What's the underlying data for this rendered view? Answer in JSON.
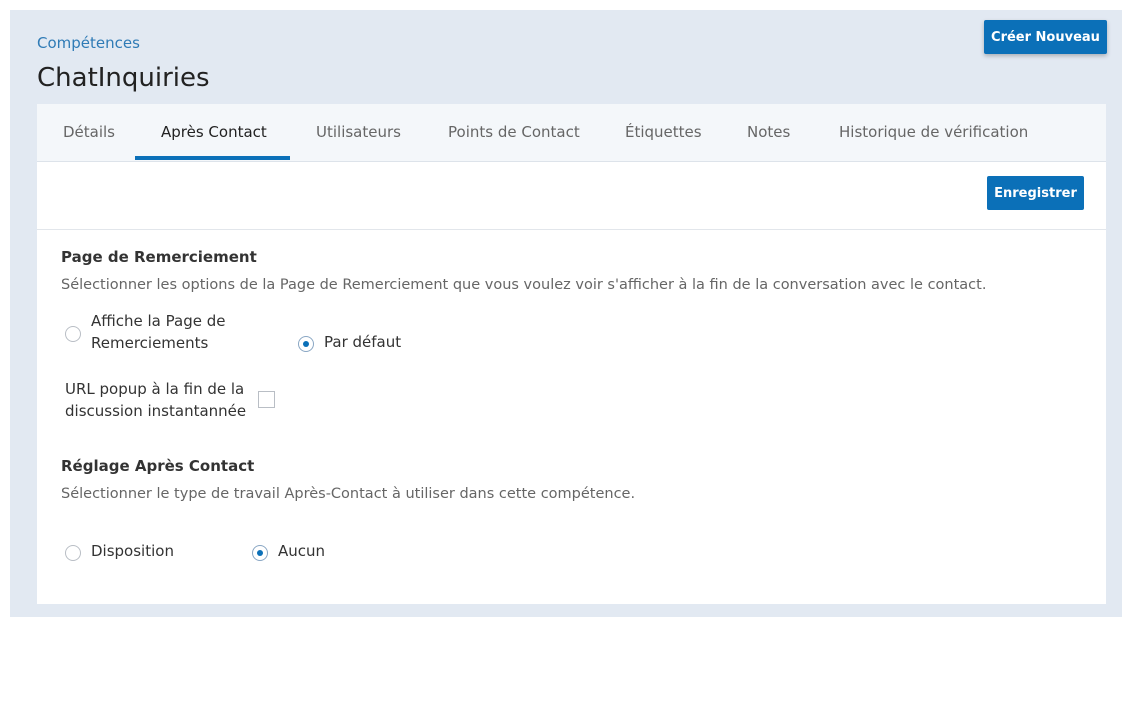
{
  "breadcrumb": "Compétences",
  "page_title": "ChatInquiries",
  "header": {
    "create_label": "Créer Nouveau"
  },
  "tabs": [
    {
      "label": "Détails"
    },
    {
      "label": "Après Contact",
      "active": true
    },
    {
      "label": "Utilisateurs"
    },
    {
      "label": "Points de Contact"
    },
    {
      "label": "Étiquettes"
    },
    {
      "label": "Notes"
    },
    {
      "label": "Historique de vérification"
    }
  ],
  "toolbar": {
    "save_label": "Enregistrer"
  },
  "thankyou": {
    "title": "Page de Remerciement",
    "description": "Sélectionner les options de la Page de Remerciement que vous voulez voir s'afficher à la fin de la conversation avec le contact.",
    "options": [
      {
        "line1": "Affiche la Page de",
        "line2": "Remerciements",
        "selected": false
      },
      {
        "label": "Par défaut",
        "selected": true
      }
    ],
    "url_popup": {
      "line1": "URL popup à la fin de la",
      "line2": "discussion instantannée",
      "checked": false
    }
  },
  "after_contact": {
    "title": "Réglage Après Contact",
    "description": "Sélectionner le type de travail Après-Contact à utiliser dans cette compétence.",
    "options": [
      {
        "label": "Disposition",
        "selected": false
      },
      {
        "label": "Aucun",
        "selected": true
      }
    ]
  },
  "colors": {
    "accent": "#0b70b8",
    "link": "#2f7bb6",
    "panel_bg": "#e2e9f2"
  }
}
